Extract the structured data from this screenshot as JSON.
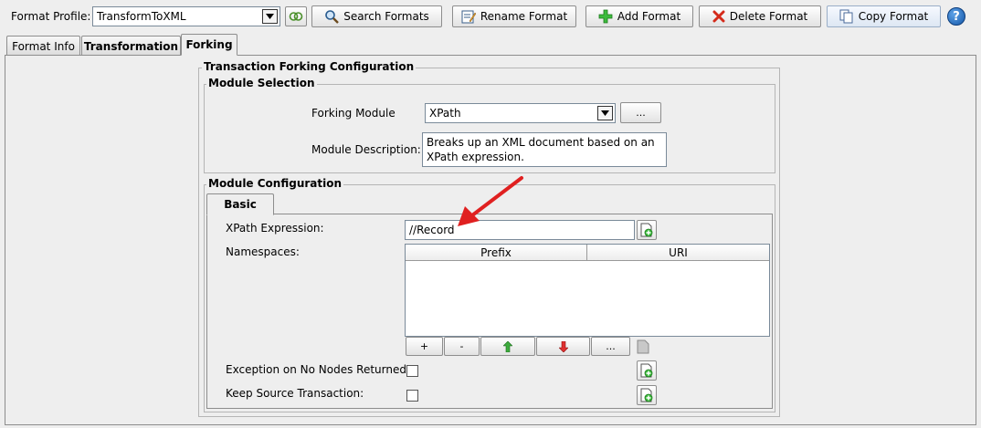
{
  "toolbar": {
    "format_profile_label": "Format Profile:",
    "format_profile_value": "TransformToXML",
    "search_label": "Search Formats",
    "rename_label": "Rename Format",
    "add_label": "Add Format",
    "delete_label": "Delete Format",
    "copy_label": "Copy Format",
    "help_label": "?"
  },
  "tabs": [
    {
      "label": "Format Info",
      "active": false
    },
    {
      "label": "Transformation",
      "active": false
    },
    {
      "label": "Forking",
      "active": true
    }
  ],
  "forking": {
    "group_title": "Transaction Forking Configuration",
    "module_selection": {
      "title": "Module Selection",
      "forking_module_label": "Forking Module",
      "forking_module_value": "XPath",
      "browse_label": "...",
      "description_label": "Module Description:",
      "description_line1": "Breaks up an XML document based on an",
      "description_line2": "XPath expression."
    },
    "module_configuration": {
      "title": "Module Configuration",
      "tab_label": "Basic",
      "xpath_label": "XPath Expression:",
      "xpath_value": "//Record",
      "namespaces_label": "Namespaces:",
      "columns": [
        "Prefix",
        "URI"
      ],
      "table_buttons": {
        "add": "+",
        "remove": "-",
        "more": "..."
      },
      "exception_label": "Exception on No Nodes Returned:",
      "keep_source_label": "Keep Source Transaction:",
      "exception_checked": false,
      "keep_source_checked": false
    }
  },
  "colors": {
    "annotation_arrow": "#e02020",
    "background": "#eeeeee"
  }
}
